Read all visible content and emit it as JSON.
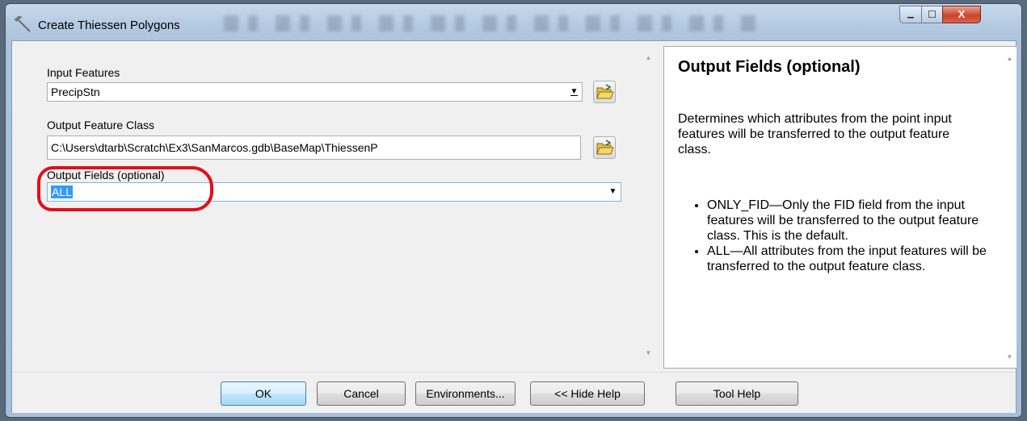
{
  "window": {
    "title": "Create Thiessen Polygons",
    "controls": {
      "minimize": "▁",
      "maximize": "☐",
      "close": "X"
    }
  },
  "form": {
    "input_features": {
      "label": "Input Features",
      "value": "PrecipStn"
    },
    "output_feature_class": {
      "label": "Output Feature Class",
      "value": "C:\\Users\\dtarb\\Scratch\\Ex3\\SanMarcos.gdb\\BaseMap\\ThiessenP"
    },
    "output_fields": {
      "label": "Output Fields (optional)",
      "value": "ALL"
    }
  },
  "help": {
    "title": "Output Fields (optional)",
    "description": "Determines which attributes from the point input features will be transferred to the output feature class.",
    "options": [
      "ONLY_FID—Only the FID field from the input features will be transferred to the output feature class. This is the default.",
      "ALL—All attributes from the input features will be transferred to the output feature class."
    ]
  },
  "buttons": {
    "ok": "OK",
    "cancel": "Cancel",
    "environments": "Environments...",
    "hide_help": "<< Hide Help",
    "tool_help": "Tool Help"
  },
  "icons": {
    "title": "hammer-icon",
    "browse": "open-folder-icon",
    "dropdown": "dropdown-arrow-icon"
  },
  "colors": {
    "highlight_annotation": "#e0101a",
    "selection": "#3399ff"
  }
}
